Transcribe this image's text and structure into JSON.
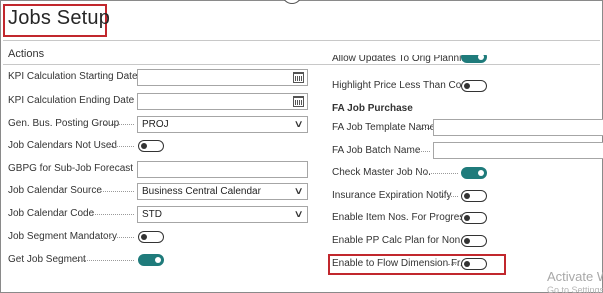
{
  "page": {
    "title": "Jobs Setup",
    "actions_label": "Actions"
  },
  "left": {
    "kpi_start": {
      "label": "KPI Calculation Starting Date",
      "value": ""
    },
    "kpi_end": {
      "label": "KPI Calculation Ending Date",
      "value": ""
    },
    "gen_bus": {
      "label": "Gen. Bus. Posting Group",
      "value": "PROJ"
    },
    "job_cal_not_used": {
      "label": "Job Calendars Not Used",
      "on": false
    },
    "gbpg_sub": {
      "label": "GBPG for Sub-Job Forecast",
      "value": ""
    },
    "job_cal_source": {
      "label": "Job Calendar Source",
      "value": "Business Central Calendar"
    },
    "job_cal_code": {
      "label": "Job Calendar Code",
      "value": "STD"
    },
    "job_seg_mand": {
      "label": "Job Segment Mandatory",
      "on": false
    },
    "get_job_seg": {
      "label": "Get Job Segment",
      "on": true
    }
  },
  "right": {
    "allow_updates": {
      "label": "Allow Updates To Orig Planni...",
      "on": true
    },
    "highlight_price": {
      "label": "Highlight Price Less Than Cost",
      "on": false
    },
    "fa_section": "FA Job Purchase",
    "fa_template": {
      "label": "FA Job Template Name",
      "value": ""
    },
    "fa_batch": {
      "label": "FA Job Batch Name",
      "value": ""
    },
    "check_master": {
      "label": "Check Master Job No.",
      "on": true
    },
    "insurance": {
      "label": "Insurance Expiration Notify",
      "on": false
    },
    "enable_item": {
      "label": "Enable Item Nos. For Progres...",
      "on": false
    },
    "enable_pp": {
      "label": "Enable PP Calc Plan for Non I...",
      "on": false
    },
    "enable_flow": {
      "label": "Enable to Flow Dimension Fr...",
      "on": false
    }
  },
  "watermark": {
    "title": "Activate W",
    "subtitle": "Go to Settings"
  },
  "colors": {
    "toggle_on": "#1f7b7b",
    "highlight": "#c1272d"
  },
  "icons": {
    "date": "calendar-icon",
    "dropdown": "chevron-down-icon"
  }
}
